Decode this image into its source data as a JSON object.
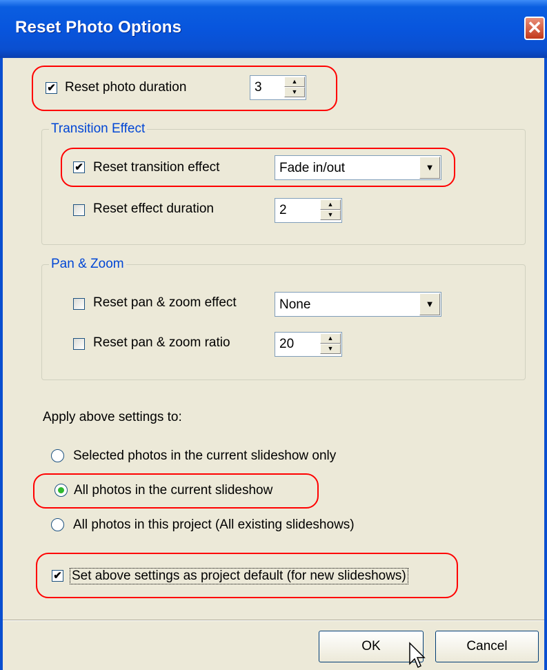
{
  "window": {
    "title": "Reset Photo Options",
    "close_symbol": "✕"
  },
  "photo_duration": {
    "label": "Reset photo duration",
    "checked": true,
    "value": "3"
  },
  "transition_group": {
    "title": "Transition Effect",
    "effect": {
      "label": "Reset transition effect",
      "checked": true,
      "value": "Fade in/out"
    },
    "duration": {
      "label": "Reset effect duration",
      "checked": false,
      "value": "2"
    }
  },
  "pan_zoom_group": {
    "title": "Pan & Zoom",
    "effect": {
      "label": "Reset pan & zoom effect",
      "checked": false,
      "value": "None"
    },
    "ratio": {
      "label": "Reset pan & zoom ratio",
      "checked": false,
      "value": "20"
    }
  },
  "apply": {
    "heading": "Apply above settings to:",
    "options": [
      {
        "label": "Selected photos in the current slideshow only",
        "selected": false
      },
      {
        "label": "All photos in the current slideshow",
        "selected": true
      },
      {
        "label": "All photos in this project (All existing slideshows)",
        "selected": false
      }
    ]
  },
  "project_default": {
    "label": "Set above settings as project default (for new slideshows)",
    "checked": true
  },
  "buttons": {
    "ok": "OK",
    "cancel": "Cancel"
  },
  "glyphs": {
    "check": "✔",
    "up": "▲",
    "down": "▼",
    "dropdown": "▼"
  },
  "colors": {
    "title_bar": "#0a5ee0",
    "dialog_bg": "#ece9d8",
    "highlight_box": "#ff0000",
    "group_title": "#0046d5"
  }
}
